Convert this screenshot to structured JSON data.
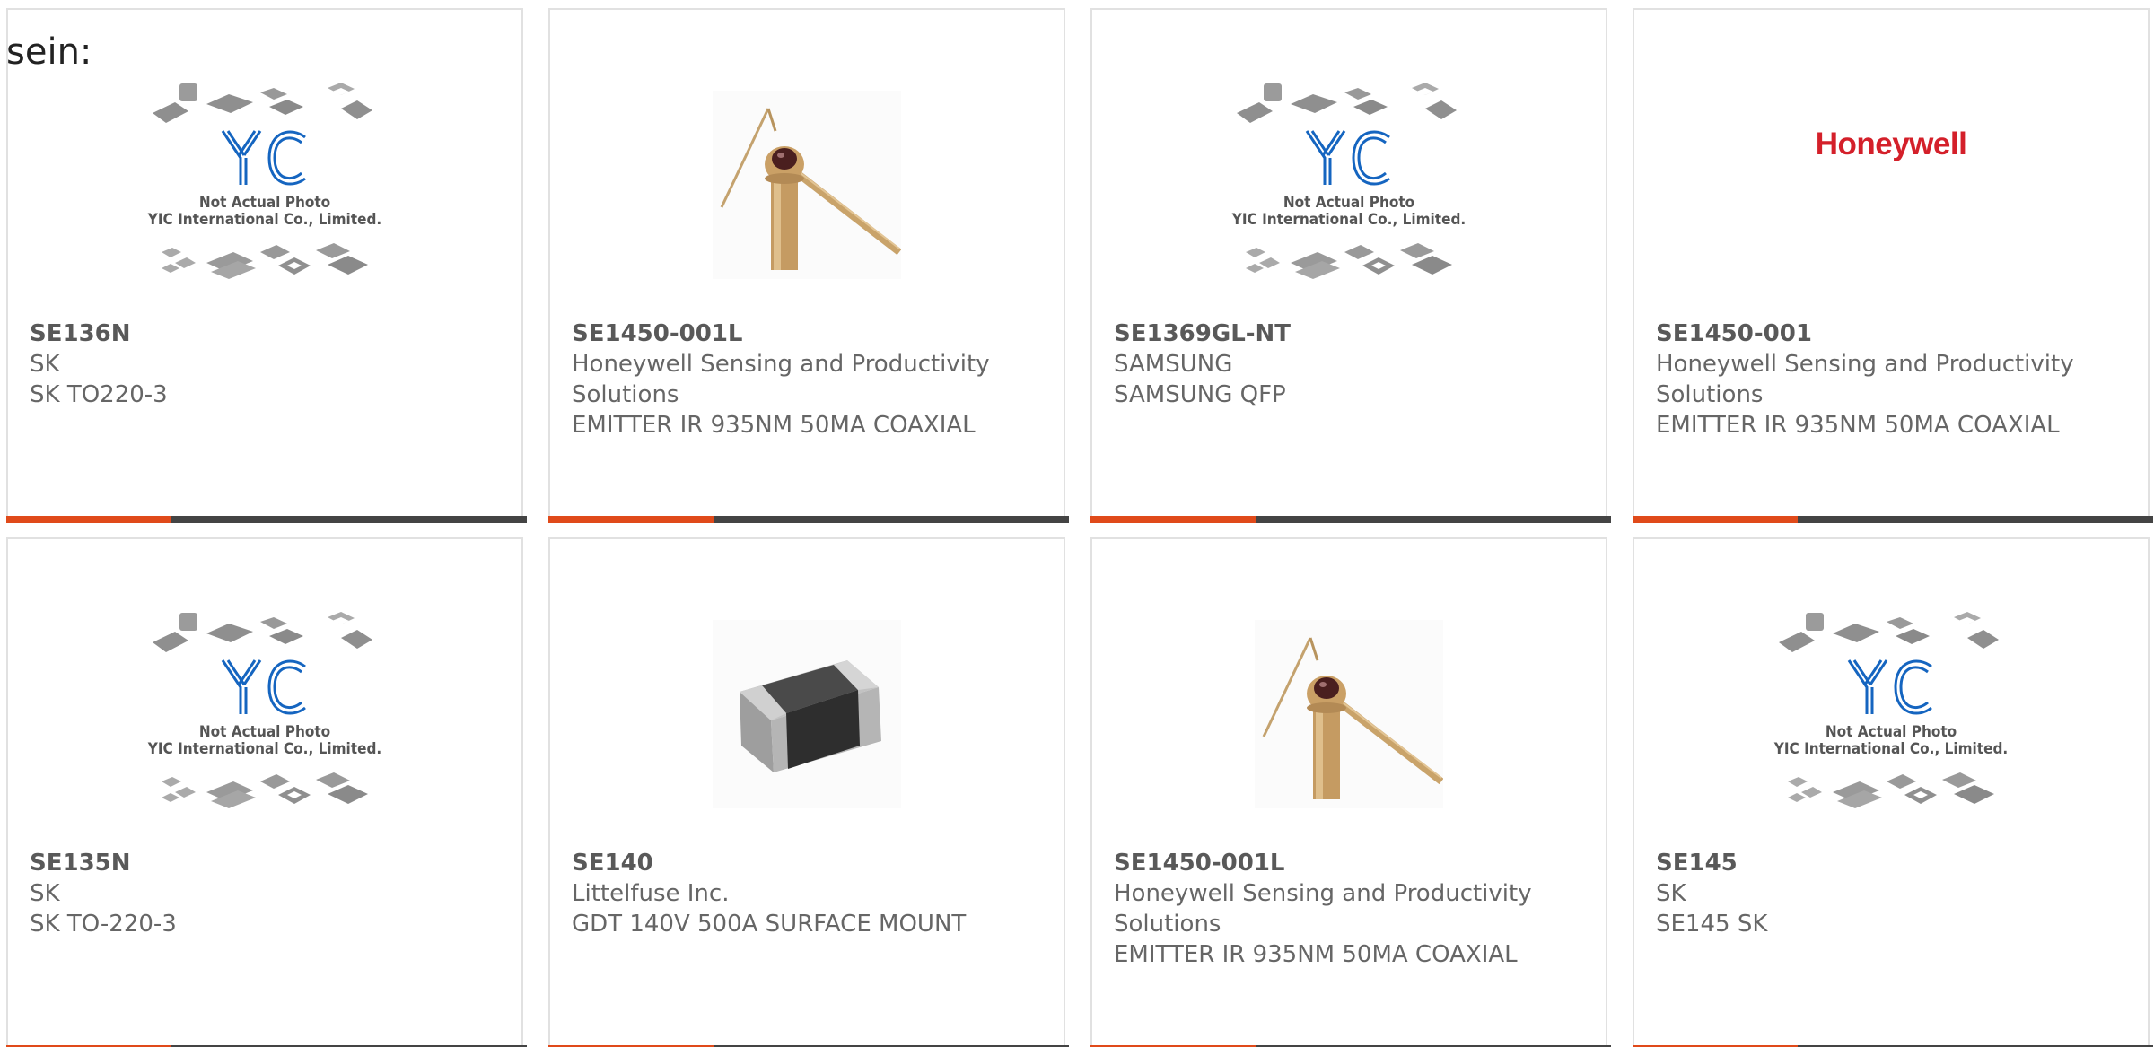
{
  "intro_text": "sein:",
  "colors": {
    "accent": "#e04a1a",
    "bar": "#444444",
    "border": "#e1e1e1",
    "text": "#666666",
    "yic_blue": "#1565c0",
    "honeywell_red": "#d4202a"
  },
  "products": [
    {
      "part_number": "SE136N",
      "manufacturer": "SK",
      "description": "SK TO220-3",
      "image": "yic-placeholder"
    },
    {
      "part_number": "SE1450-001L",
      "manufacturer": "Honeywell Sensing and Productivity Solutions",
      "description": "EMITTER IR 935NM 50MA COAXIAL",
      "image": "ir-emitter-photo"
    },
    {
      "part_number": "SE1369GL-NT",
      "manufacturer": "SAMSUNG",
      "description": "SAMSUNG QFP",
      "image": "yic-placeholder"
    },
    {
      "part_number": "SE1450-001",
      "manufacturer": "Honeywell Sensing and Productivity Solutions",
      "description": "EMITTER IR 935NM 50MA COAXIAL",
      "image": "honeywell-logo"
    },
    {
      "part_number": "SE135N",
      "manufacturer": "SK",
      "description": "SK TO-220-3",
      "image": "yic-placeholder"
    },
    {
      "part_number": "SE140",
      "manufacturer": "Littelfuse Inc.",
      "description": "GDT 140V 500A SURFACE MOUNT",
      "image": "smd-gdt-photo"
    },
    {
      "part_number": "SE1450-001L",
      "manufacturer": "Honeywell Sensing and Productivity Solutions",
      "description": "EMITTER IR 935NM 50MA COAXIAL",
      "image": "ir-emitter-photo"
    },
    {
      "part_number": "SE145",
      "manufacturer": "SK",
      "description": "SE145 SK",
      "image": "yic-placeholder"
    }
  ],
  "placeholder": {
    "line1": "Not Actual Photo",
    "line2": "YIC International Co., Limited.",
    "logo_text": "YIC"
  },
  "honeywell_logo_text": "Honeywell"
}
